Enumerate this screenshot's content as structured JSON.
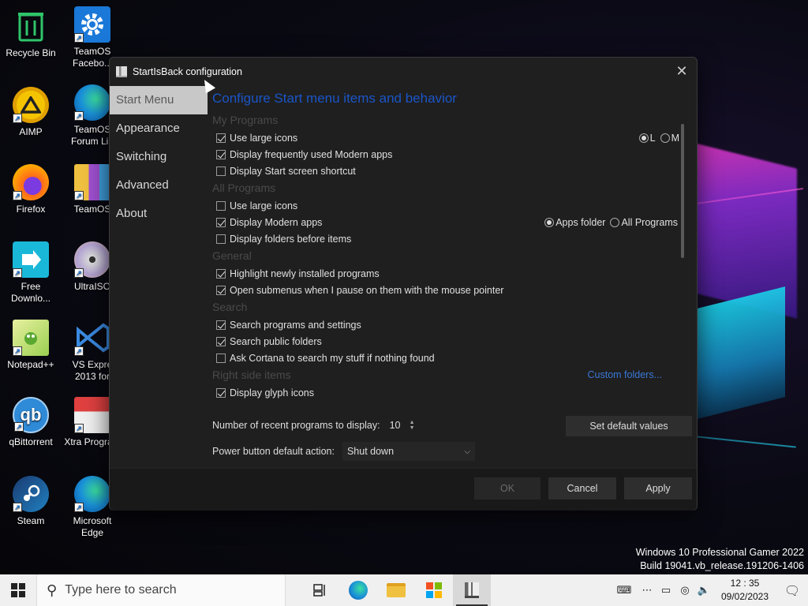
{
  "desktop": {
    "icons": [
      {
        "label": "Recycle Bin",
        "icon": "recycle-bin-icon"
      },
      {
        "label": "TeamOS Facebo...",
        "icon": "gear-icon"
      },
      {
        "label": "AIMP",
        "icon": "aimp-icon"
      },
      {
        "label": "TeamOS Forum Lin",
        "icon": "edge-icon"
      },
      {
        "label": "Firefox",
        "icon": "firefox-icon"
      },
      {
        "label": "TeamOS",
        "icon": "folder-icon"
      },
      {
        "label": "Free Downlo...",
        "icon": "download-icon"
      },
      {
        "label": "UltraISO",
        "icon": "disc-icon"
      },
      {
        "label": "Notepad++",
        "icon": "notepad-icon"
      },
      {
        "label": "VS Expre 2013 for",
        "icon": "visual-studio-icon"
      },
      {
        "label": "qBittorrent",
        "icon": "qbittorrent-icon"
      },
      {
        "label": "Xtra Program",
        "icon": "installer-icon"
      },
      {
        "label": "Steam",
        "icon": "steam-icon"
      },
      {
        "label": "Microsoft Edge",
        "icon": "edge-icon"
      }
    ]
  },
  "dialog": {
    "title": "StartIsBack configuration",
    "sidebar": [
      "Start Menu",
      "Appearance",
      "Switching",
      "Advanced",
      "About"
    ],
    "heading": "Configure Start menu items and behavior",
    "sections": {
      "my_programs": "My Programs",
      "all_programs": "All Programs",
      "general": "General",
      "search": "Search",
      "right_side": "Right side items"
    },
    "options": {
      "mp_large_icons": "Use large icons",
      "mp_large_L": "L",
      "mp_large_M": "M",
      "mp_frequent_modern": "Display frequently used Modern apps",
      "mp_start_shortcut": "Display Start screen shortcut",
      "ap_large_icons": "Use large icons",
      "ap_modern_apps": "Display Modern apps",
      "ap_apps_folder": "Apps folder",
      "ap_all_programs": "All Programs",
      "ap_folders_before": "Display folders before items",
      "gen_highlight": "Highlight newly installed programs",
      "gen_open_submenus": "Open submenus when I pause on them with the mouse pointer",
      "s_programs": "Search programs and settings",
      "s_public": "Search public folders",
      "s_cortana": "Ask Cortana to search my stuff if nothing found",
      "rs_custom_folders": "Custom folders...",
      "rs_glyph_icons": "Display glyph icons"
    },
    "recent_label": "Number of recent programs to display:",
    "recent_value": "10",
    "set_default": "Set default values",
    "power_label": "Power button default action:",
    "power_value": "Shut down",
    "ok": "OK",
    "cancel": "Cancel",
    "apply": "Apply"
  },
  "watermark": {
    "line1": "Windows 10 Professional Gamer 2022",
    "line2": "Build 19041.vb_release.191206-1406"
  },
  "taskbar": {
    "search_placeholder": "Type here to search",
    "time": "12 : 35",
    "date": "09/02/2023"
  }
}
